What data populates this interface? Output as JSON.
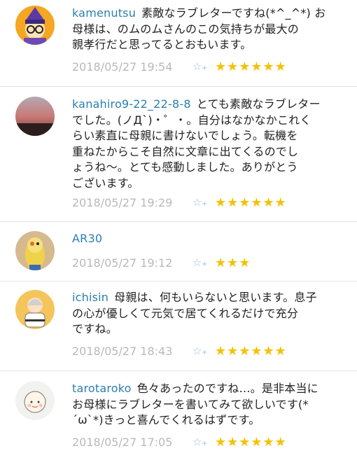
{
  "comments": [
    {
      "username": "kamenutsu",
      "text": "素敵なラブレターですね(*^_^*) お母様は、のムのムさんのこの気持ちが最大の親孝行だと思ってるとおもいます。",
      "lines": [
        "素敵なラブレターですね(*^_^*) お",
        "母様は、のムのムさんのこの気持ちが最大の",
        "親孝行だと思ってるとおもいます。"
      ],
      "timestamp": "2018/05/27 19:54",
      "stars": "★★★★★★",
      "avatar_icon": "cartoon-person-avatar"
    },
    {
      "username": "kanahiro9-22_22-8-8",
      "lines": [
        "とても素敵なラブレター",
        "でした。(ノД`)・゜・。自分はなかなかこれく",
        "らい素直に母親に書けないでしょう。転機を",
        "重ねたからこそ自然に文章に出てくるのでし",
        "ょうね〜。とても感動しました。ありがとう",
        "ございます。"
      ],
      "timestamp": "2018/05/27 19:29",
      "stars": "★★★★★★",
      "avatar_icon": "sunset-sky-avatar"
    },
    {
      "username": "AR30",
      "lines": [
        ""
      ],
      "timestamp": "2018/05/27 19:12",
      "stars": "★★★",
      "avatar_icon": "parrot-avatar"
    },
    {
      "username": "ichisin",
      "lines": [
        "母親は、何もいらないと思います。息子",
        "の心が優しくて元気で居てくれるだけで充分",
        "ですね。"
      ],
      "timestamp": "2018/05/27 18:43",
      "stars": "★★★★★★",
      "avatar_icon": "martial-artist-avatar"
    },
    {
      "username": "tarotaroko",
      "lines": [
        "色々あったのですね…。是非本当に",
        "お母様にラブレターを書いてみて欲しいです(*",
        "´ω`*)きっと喜んでくれるはずです。"
      ],
      "timestamp": "2018/05/27 17:05",
      "stars": "★★★★★★",
      "avatar_icon": "baby-sketch-avatar"
    }
  ],
  "colors": {
    "username": "#2a7fb0",
    "timestamp": "#b9b9b9",
    "stars": "#f2c200",
    "add_star": "#9dbde0"
  }
}
